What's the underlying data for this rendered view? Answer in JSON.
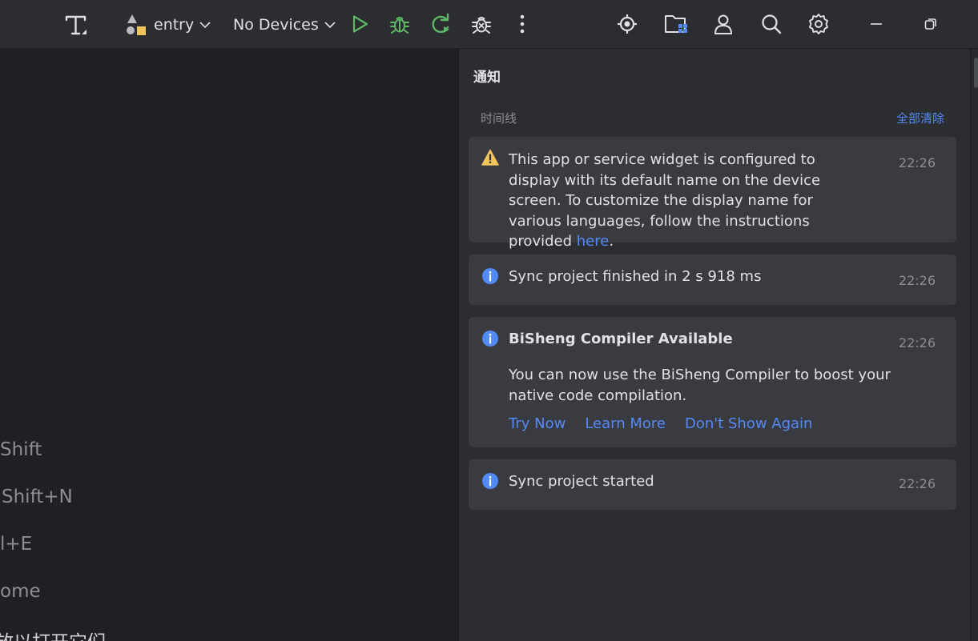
{
  "toolbar": {
    "module_name": "entry",
    "device_selector": "No Devices"
  },
  "editor_hints": [
    "Shift",
    "Shift+N",
    "l+E",
    "ome",
    "放以打开它们"
  ],
  "notifications_panel": {
    "title": "通知",
    "timeline_label": "时间线",
    "clear_all": "全部清除",
    "items": [
      {
        "type": "warning",
        "text_before_link": "This app or service widget is configured to display with its default name on the device screen. To customize the display name for various languages, follow the instructions provided ",
        "link": "here",
        "text_after_link": ".",
        "time": "22:26"
      },
      {
        "type": "info",
        "text": "Sync project finished in 2 s 918 ms",
        "time": "22:26"
      },
      {
        "type": "info",
        "title": "BiSheng Compiler Available",
        "body": "You can now use the BiSheng Compiler to boost your native code compilation.",
        "actions": [
          "Try Now",
          "Learn More",
          "Don't Show Again"
        ],
        "time": "22:26"
      },
      {
        "type": "info",
        "text": "Sync project started",
        "time": "22:26"
      }
    ]
  },
  "colors": {
    "background": "#2b2d30",
    "editor_background": "#1f2024",
    "card_background": "#393b40",
    "link": "#548af7",
    "run_green": "#5fb865",
    "warning_yellow": "#f2c55c",
    "info_blue": "#548af7"
  }
}
